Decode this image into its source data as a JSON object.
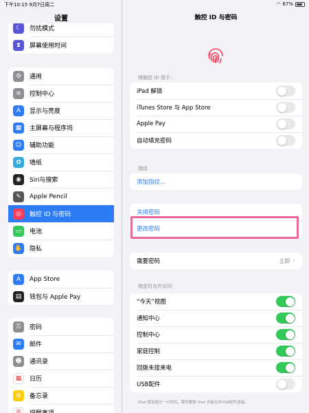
{
  "status_bar": {
    "time_date": "下午10:15  9月7日周二",
    "battery": "67%"
  },
  "sidebar": {
    "title": "设置",
    "group1": [
      {
        "label": "勿扰模式",
        "icon": "moon-icon",
        "color": "#5856d6"
      },
      {
        "label": "屏幕使用时间",
        "icon": "hourglass-icon",
        "color": "#5856d6"
      }
    ],
    "group2": [
      {
        "label": "通用",
        "icon": "gear-icon",
        "color": "#8e8e93"
      },
      {
        "label": "控制中心",
        "icon": "switches-icon",
        "color": "#8e8e93"
      },
      {
        "label": "显示与亮度",
        "icon": "text-size-icon",
        "color": "#2d7cf6"
      },
      {
        "label": "主屏幕与程序坞",
        "icon": "grid-icon",
        "color": "#2d7cf6"
      },
      {
        "label": "辅助功能",
        "icon": "accessibility-icon",
        "color": "#2d7cf6"
      },
      {
        "label": "墙纸",
        "icon": "flower-icon",
        "color": "#35aadc"
      },
      {
        "label": "Siri与搜索",
        "icon": "siri-icon",
        "color": "#222222"
      },
      {
        "label": "Apple Pencil",
        "icon": "pencil-icon",
        "color": "#555555"
      },
      {
        "label": "触控 ID 与密码",
        "icon": "fingerprint-icon",
        "color": "#ff3b5c",
        "selected": true
      },
      {
        "label": "电池",
        "icon": "battery-icon",
        "color": "#34c759"
      },
      {
        "label": "隐私",
        "icon": "hand-icon",
        "color": "#2d7cf6"
      }
    ],
    "group3": [
      {
        "label": "App Store",
        "icon": "app-store-icon",
        "color": "#2d7cf6"
      },
      {
        "label": "钱包与 Apple Pay",
        "icon": "wallet-icon",
        "color": "#222222"
      }
    ],
    "group4": [
      {
        "label": "密码",
        "icon": "key-icon",
        "color": "#8e8e93"
      },
      {
        "label": "邮件",
        "icon": "mail-icon",
        "color": "#2d7cf6"
      },
      {
        "label": "通讯录",
        "icon": "contacts-icon",
        "color": "#8e8e93"
      },
      {
        "label": "日历",
        "icon": "calendar-icon",
        "color": "#ffffff"
      },
      {
        "label": "备忘录",
        "icon": "notes-icon",
        "color": "#ffcc00"
      },
      {
        "label": "提醒事项",
        "icon": "reminders-icon",
        "color": "#ffffff"
      }
    ]
  },
  "main": {
    "title": "触控 ID 与密码",
    "use_touch_id_header": "将触控 ID 用于：",
    "touch_id_rows": [
      {
        "label": "iPad 解锁",
        "on": false
      },
      {
        "label": "iTunes Store 与 App Store",
        "on": false
      },
      {
        "label": "Apple Pay",
        "on": false
      },
      {
        "label": "自动填充密码",
        "on": false
      }
    ],
    "fingerprints_header": "指纹",
    "add_fingerprint": "添加指纹…",
    "turn_off_passcode": "关闭密码",
    "change_passcode": "更改密码",
    "require_passcode": "需要密码",
    "require_passcode_value": "立即",
    "locked_access_header": "锁定时允许访问：",
    "locked_rows": [
      {
        "label": "“今天”视图",
        "on": true
      },
      {
        "label": "通知中心",
        "on": true
      },
      {
        "label": "控制中心",
        "on": true
      },
      {
        "label": "家庭控制",
        "on": true
      },
      {
        "label": "回拨未接来电",
        "on": true
      },
      {
        "label": "USB配件",
        "on": false
      }
    ],
    "usb_footer": "iPad 锁定超过一小时后，需先解锁 iPad 才能允许USB配件连接。"
  }
}
